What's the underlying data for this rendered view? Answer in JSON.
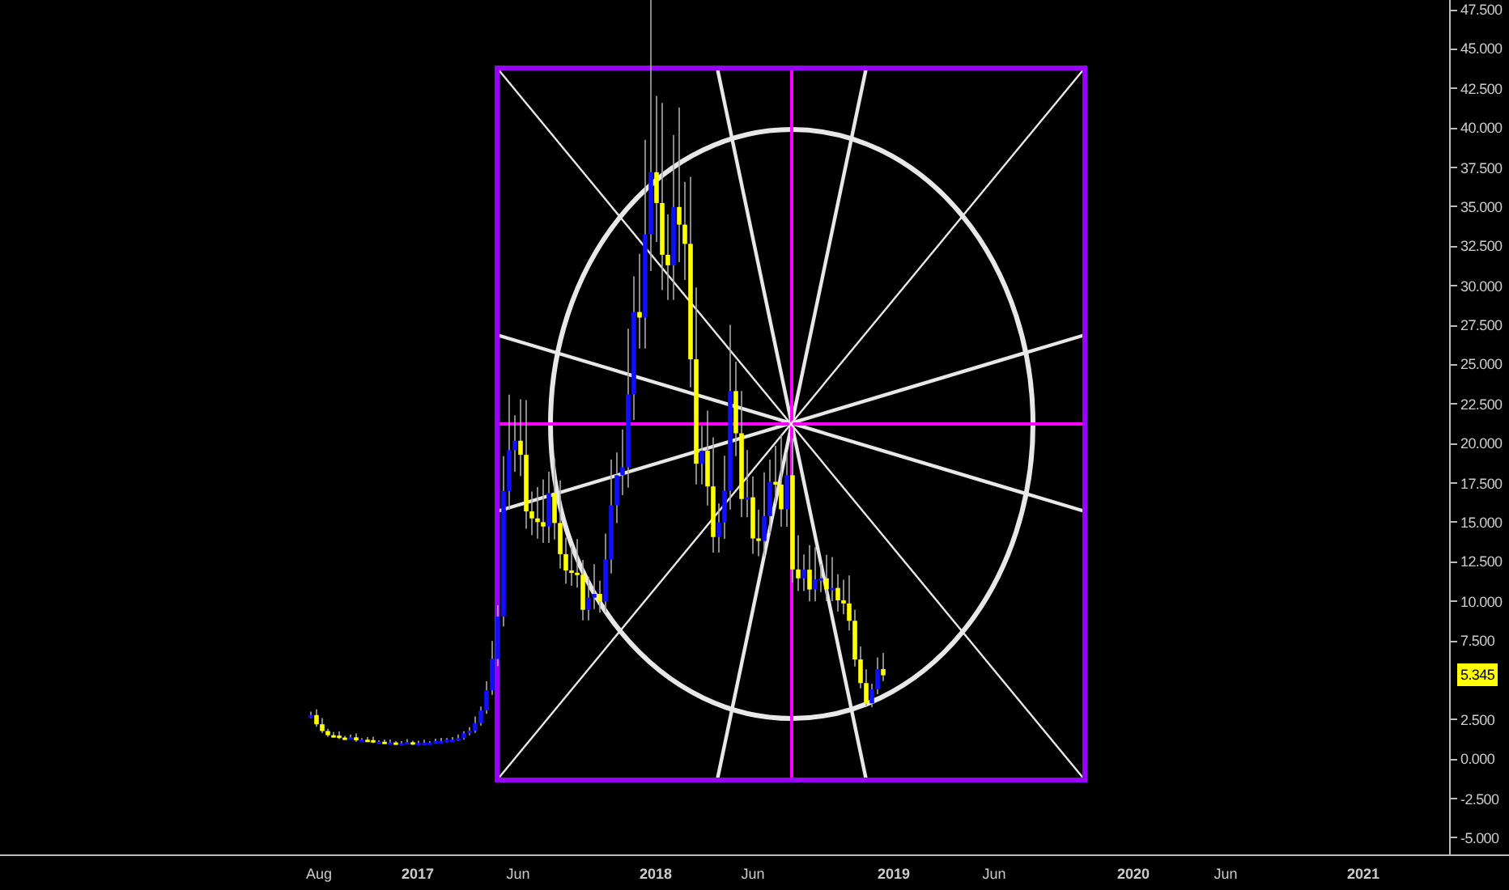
{
  "price_axis": {
    "ticks": [
      "47.500",
      "45.000",
      "42.500",
      "40.000",
      "37.500",
      "35.000",
      "32.500",
      "30.000",
      "27.500",
      "25.000",
      "22.500",
      "20.000",
      "17.500",
      "15.000",
      "12.500",
      "10.000",
      "7.500",
      "2.500",
      "0.000",
      "-2.500",
      "-5.000"
    ]
  },
  "last_price": {
    "value": "5.345"
  },
  "time_axis": {
    "ticks": [
      {
        "label": "Aug",
        "kind": "month"
      },
      {
        "label": "2017",
        "kind": "year"
      },
      {
        "label": "Jun",
        "kind": "month"
      },
      {
        "label": "2018",
        "kind": "year"
      },
      {
        "label": "Jun",
        "kind": "month"
      },
      {
        "label": "2019",
        "kind": "year"
      },
      {
        "label": "Jun",
        "kind": "month"
      },
      {
        "label": "2020",
        "kind": "year"
      },
      {
        "label": "Jun",
        "kind": "month"
      },
      {
        "label": "2021",
        "kind": "year"
      }
    ]
  }
}
